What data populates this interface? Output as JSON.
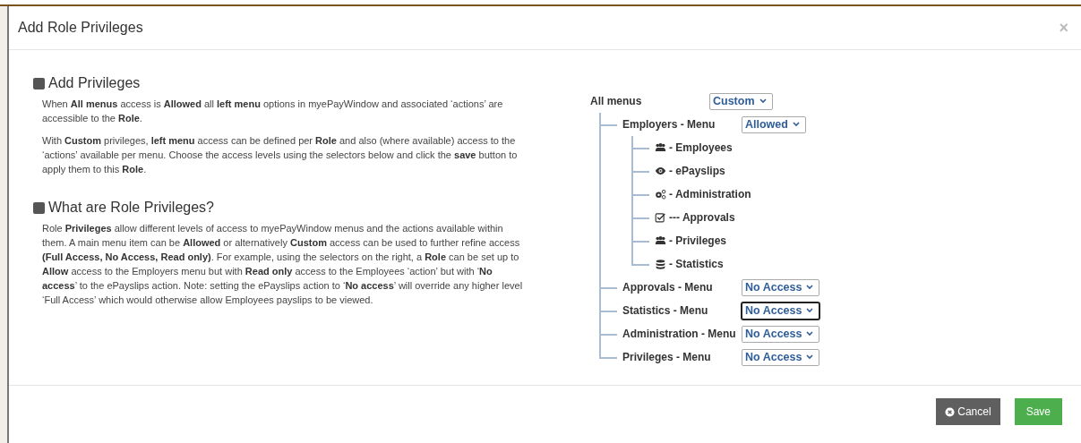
{
  "dialog": {
    "title": "Add Role Privileges",
    "close": "×"
  },
  "sections": [
    {
      "heading": "Add Privileges",
      "paragraphs": [
        "When **All menus** access is **Allowed** all **left menu** options in myePayWindow and associated ‘actions’ are accessible to the **Role**.",
        "With **Custom** privileges, **left menu** access can be defined per **Role** and also (where available) access to the ‘actions’ available per menu. Choose the access levels using the selectors below and click the **save** button to apply them to this **Role**."
      ]
    },
    {
      "heading": "What are Role Privileges?",
      "paragraphs": [
        "Role **Privileges** allow different levels of access to myePayWindow menus and the actions available within them. A main menu item can be **Allowed** or alternatively **Custom** access can be used to further refine access **(Full Access, No Access, Read only)**. For example, using the selectors on the right, a **Role** can be set up to **Allow** access to the Employers menu but with **Read only** access to the Employees ‘action’ but with ‘**No access**’ to the ePayslips action. Note: setting the ePayslips action to ‘**No access**’ will override any higher level ‘Full Access’ which would otherwise allow Employees payslips to be viewed."
      ]
    }
  ],
  "tree": {
    "label": "All menus",
    "access": "Custom",
    "focused": false,
    "children": [
      {
        "label": "Employers - Menu",
        "access": "Allowed",
        "focused": false,
        "children": [
          {
            "label": "- Employees",
            "kind": "users"
          },
          {
            "label": "- ePayslips",
            "kind": "eye"
          },
          {
            "label": "- Administration",
            "kind": "cogs"
          },
          {
            "label": "--- Approvals",
            "kind": "check"
          },
          {
            "label": "- Privileges",
            "kind": "users"
          },
          {
            "label": "- Statistics",
            "kind": "database"
          }
        ]
      },
      {
        "label": "Approvals - Menu",
        "access": "No Access",
        "focused": false
      },
      {
        "label": "Statistics - Menu",
        "access": "No Access",
        "focused": true
      },
      {
        "label": "Administration - Menu",
        "access": "No Access",
        "focused": false
      },
      {
        "label": "Privileges - Menu",
        "access": "No Access",
        "focused": false
      }
    ]
  },
  "buttons": [
    {
      "label": "Cancel",
      "kind": "cancel"
    },
    {
      "label": "Save",
      "kind": "save"
    }
  ]
}
